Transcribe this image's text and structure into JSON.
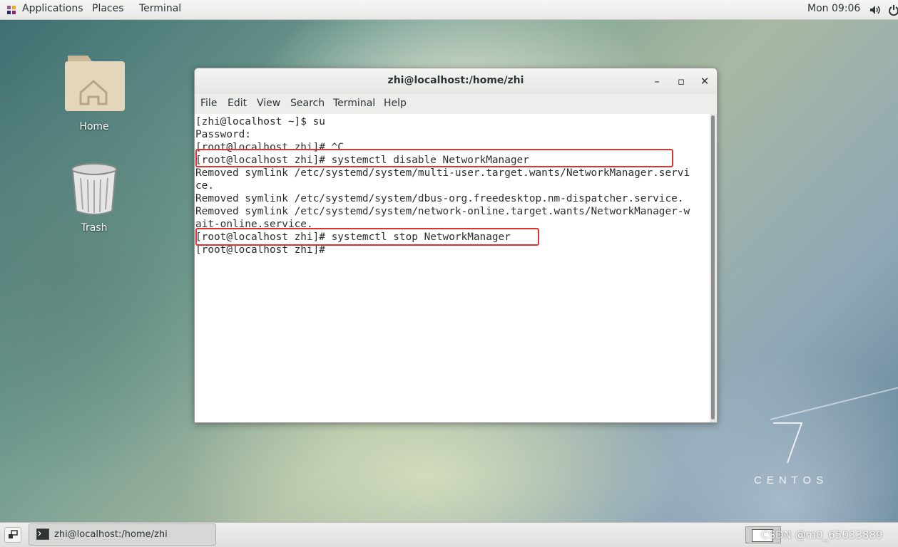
{
  "topbar": {
    "applications": "Applications",
    "places": "Places",
    "terminal": "Terminal",
    "clock": "Mon 09:06"
  },
  "desktop": {
    "icons": [
      {
        "label": "Home",
        "icon": "home-folder-icon"
      },
      {
        "label": "Trash",
        "icon": "trash-icon"
      }
    ],
    "branding_number": "7",
    "branding_text": "CENTOS"
  },
  "window": {
    "title": "zhi@localhost:/home/zhi",
    "controls": {
      "minimize": "–",
      "maximize": "▫",
      "close": "✕"
    },
    "menu": [
      "File",
      "Edit",
      "View",
      "Search",
      "Terminal",
      "Help"
    ],
    "lines": [
      "[zhi@localhost ~]$ su",
      "Password:",
      "[root@localhost zhi]# ^C",
      "[root@localhost zhi]# systemctl disable NetworkManager",
      "Removed symlink /etc/systemd/system/multi-user.target.wants/NetworkManager.servi",
      "ce.",
      "Removed symlink /etc/systemd/system/dbus-org.freedesktop.nm-dispatcher.service.",
      "Removed symlink /etc/systemd/system/network-online.target.wants/NetworkManager-w",
      "ait-online.service.",
      "[root@localhost zhi]# systemctl stop NetworkManager",
      "[root@localhost zhi]#"
    ],
    "highlight_color": "#e0322f"
  },
  "taskbar": {
    "task_label": "zhi@localhost:/home/zhi",
    "watermark": "CSDN @m0_65033889"
  }
}
